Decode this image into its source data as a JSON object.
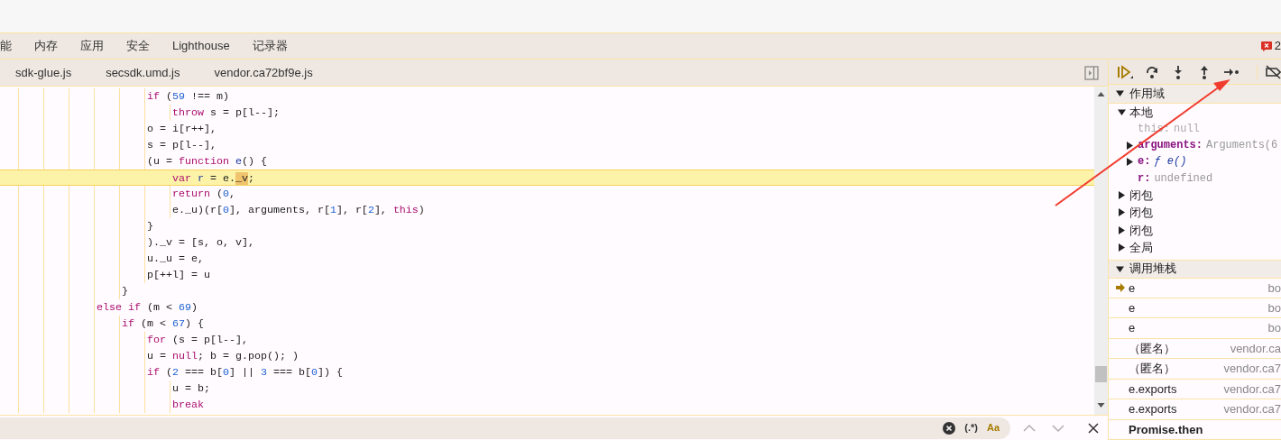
{
  "panel_tabs": [
    {
      "label": "能",
      "selected": false
    },
    {
      "label": "内存",
      "selected": false
    },
    {
      "label": "应用",
      "selected": false
    },
    {
      "label": "安全",
      "selected": false
    },
    {
      "label": "Lighthouse",
      "selected": false
    },
    {
      "label": "记录器",
      "selected": false
    }
  ],
  "issues_count": "2",
  "file_tabs": [
    {
      "label": "sdk-glue.js",
      "selected": false
    },
    {
      "label": "secsdk.umd.js",
      "selected": false
    },
    {
      "label": "vendor.ca72bf9e.js",
      "selected": false
    }
  ],
  "code": {
    "lines": [
      {
        "children": [
          {
            "children": [
              {
                "paused": false,
                "tokens": [
                  {
                    "text": "if",
                    "kind": "keyword"
                  },
                  {
                    "text": " (",
                    "kind": "plain"
                  },
                  {
                    "text": "59",
                    "kind": "number"
                  },
                  {
                    "text": " !== m)",
                    "kind": "plain"
                  }
                ],
                "children": [
                  {
                    "paused": false,
                    "tokens": [
                      {
                        "text": "throw",
                        "kind": "keyword"
                      },
                      {
                        "text": " s = p[l--];",
                        "kind": "plain"
                      }
                    ]
                  }
                ]
              },
              {
                "paused": false,
                "tokens": [
                  {
                    "text": "o = i[r++],",
                    "kind": "plain"
                  }
                ]
              },
              {
                "paused": false,
                "tokens": [
                  {
                    "text": "s = p[l--],",
                    "kind": "plain"
                  }
                ]
              },
              {
                "paused": false,
                "tokens": [
                  {
                    "text": "(u = ",
                    "kind": "plain"
                  },
                  {
                    "text": "function",
                    "kind": "keyword"
                  },
                  {
                    "text": " e",
                    "kind": "identifier"
                  },
                  {
                    "text": "() {",
                    "kind": "plain"
                  }
                ],
                "children": [
                  {
                    "paused": true,
                    "tokens": [
                      {
                        "text": "var",
                        "kind": "keyword"
                      },
                      {
                        "text": " r",
                        "kind": "identifier"
                      },
                      {
                        "text": " = e.",
                        "kind": "plain"
                      },
                      {
                        "text": "_v",
                        "kind": "hit"
                      },
                      {
                        "text": ";",
                        "kind": "plain"
                      }
                    ]
                  },
                  {
                    "paused": false,
                    "tokens": [
                      {
                        "text": "return",
                        "kind": "keyword"
                      },
                      {
                        "text": " (",
                        "kind": "plain"
                      },
                      {
                        "text": "0",
                        "kind": "number"
                      },
                      {
                        "text": ",",
                        "kind": "plain"
                      }
                    ]
                  },
                  {
                    "paused": false,
                    "tokens": [
                      {
                        "text": "e._u)(r[",
                        "kind": "plain"
                      },
                      {
                        "text": "0",
                        "kind": "number"
                      },
                      {
                        "text": "], arguments, r[",
                        "kind": "plain"
                      },
                      {
                        "text": "1",
                        "kind": "number"
                      },
                      {
                        "text": "], r[",
                        "kind": "plain"
                      },
                      {
                        "text": "2",
                        "kind": "number"
                      },
                      {
                        "text": "], ",
                        "kind": "plain"
                      },
                      {
                        "text": "this",
                        "kind": "keyword"
                      },
                      {
                        "text": ")",
                        "kind": "plain"
                      }
                    ]
                  }
                ]
              },
              {
                "paused": false,
                "tokens": [
                  {
                    "text": "}",
                    "kind": "plain"
                  }
                ]
              },
              {
                "paused": false,
                "tokens": [
                  {
                    "text": ")._v = [s, o, v],",
                    "kind": "plain"
                  }
                ]
              },
              {
                "paused": false,
                "tokens": [
                  {
                    "text": "u._u = e,",
                    "kind": "plain"
                  }
                ]
              },
              {
                "paused": false,
                "tokens": [
                  {
                    "text": "p[++l] = u",
                    "kind": "plain"
                  }
                ]
              }
            ]
          },
          {
            "paused": false,
            "tokens": [
              {
                "text": "}",
                "kind": "plain"
              }
            ]
          }
        ]
      },
      {
        "paused": false,
        "tokens": [
          {
            "text": "else if",
            "kind": "keyword"
          },
          {
            "text": " (m < ",
            "kind": "plain"
          },
          {
            "text": "69",
            "kind": "number"
          },
          {
            "text": ")",
            "kind": "plain"
          }
        ],
        "children": [
          {
            "paused": false,
            "tokens": [
              {
                "text": "if",
                "kind": "keyword"
              },
              {
                "text": " (m < ",
                "kind": "plain"
              },
              {
                "text": "67",
                "kind": "number"
              },
              {
                "text": ") {",
                "kind": "plain"
              }
            ],
            "children": [
              {
                "paused": false,
                "tokens": [
                  {
                    "text": "for",
                    "kind": "keyword"
                  },
                  {
                    "text": " (s = p[l--],",
                    "kind": "plain"
                  }
                ]
              },
              {
                "paused": false,
                "tokens": [
                  {
                    "text": "u = ",
                    "kind": "plain"
                  },
                  {
                    "text": "null",
                    "kind": "keyword"
                  },
                  {
                    "text": "; b = g.pop(); )",
                    "kind": "plain"
                  }
                ]
              },
              {
                "paused": false,
                "tokens": [
                  {
                    "text": "if",
                    "kind": "keyword"
                  },
                  {
                    "text": " (",
                    "kind": "plain"
                  },
                  {
                    "text": "2",
                    "kind": "number"
                  },
                  {
                    "text": " === b[",
                    "kind": "plain"
                  },
                  {
                    "text": "0",
                    "kind": "number"
                  },
                  {
                    "text": "] || ",
                    "kind": "plain"
                  },
                  {
                    "text": "3",
                    "kind": "number"
                  },
                  {
                    "text": " === b[",
                    "kind": "plain"
                  },
                  {
                    "text": "0",
                    "kind": "number"
                  },
                  {
                    "text": "]) {",
                    "kind": "plain"
                  }
                ],
                "children": [
                  {
                    "paused": false,
                    "tokens": [
                      {
                        "text": "u = b;",
                        "kind": "plain"
                      }
                    ]
                  },
                  {
                    "paused": false,
                    "tokens": [
                      {
                        "text": "break",
                        "kind": "keyword"
                      }
                    ]
                  }
                ]
              }
            ]
          }
        ]
      }
    ]
  },
  "search": {
    "regex": {
      "label": "(.*)",
      "selected": false
    },
    "match_case": {
      "label": "Aa",
      "selected": true
    }
  },
  "scope": {
    "title": "作用域",
    "expanded": true,
    "groups": [
      {
        "label": "本地",
        "expanded": true,
        "children": [
          {
            "name": "this:",
            "value": "null",
            "kind": "null",
            "expandable": false,
            "dimmed": true
          },
          {
            "name": "arguments:",
            "value": "Arguments(6",
            "kind": "object",
            "expandable": true,
            "dimmed": false
          },
          {
            "name": "e:",
            "value": "ƒ e()",
            "kind": "function",
            "expandable": true,
            "dimmed": false
          },
          {
            "name": "r:",
            "value": "undefined",
            "kind": "undefined",
            "expandable": false,
            "dimmed": false
          }
        ]
      },
      {
        "label": "闭包",
        "expanded": false
      },
      {
        "label": "闭包",
        "expanded": false
      },
      {
        "label": "闭包",
        "expanded": false
      },
      {
        "label": "全局",
        "expanded": false
      }
    ]
  },
  "call_stack": {
    "title": "调用堆栈",
    "expanded": true,
    "frames": [
      {
        "function": "e",
        "location": "bo",
        "current": true,
        "kind": "frame"
      },
      {
        "function": "e",
        "location": "bo",
        "current": false,
        "kind": "frame"
      },
      {
        "function": "e",
        "location": "bo",
        "current": false,
        "kind": "frame"
      },
      {
        "function": "（匿名）",
        "location": "vendor.ca",
        "current": false,
        "kind": "frame"
      },
      {
        "function": "（匿名）",
        "location": "vendor.ca7",
        "current": false,
        "kind": "frame"
      },
      {
        "function": "e.exports",
        "location": "vendor.ca7",
        "current": false,
        "kind": "frame"
      },
      {
        "function": "e.exports",
        "location": "vendor.ca7",
        "current": false,
        "kind": "frame"
      },
      {
        "function": "Promise.then",
        "current": false,
        "kind": "async"
      }
    ]
  }
}
